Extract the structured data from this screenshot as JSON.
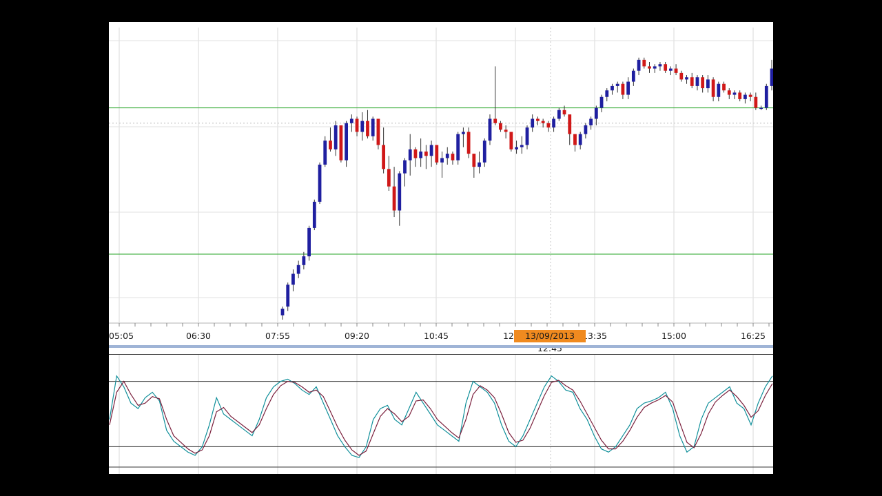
{
  "chart_data": [
    {
      "type": "candlestick",
      "x_tick_labels": [
        "05:05",
        "06:30",
        "07:55",
        "09:20",
        "10:45",
        "12:10",
        "13:35",
        "15:00",
        "16:25"
      ],
      "crosshair_label": "13/09/2013 12:45",
      "horizontal_lines": [
        {
          "name": "resistance",
          "value": 97,
          "color": "#2ea82e"
        },
        {
          "name": "support",
          "value": 30,
          "color": "#2ea82e"
        },
        {
          "name": "crosshair",
          "value": 90,
          "color": "#c7c7c7",
          "style": "dotted"
        }
      ],
      "ylim": [
        0,
        130
      ],
      "up_color": "#1f1fa0",
      "down_color": "#d01818",
      "candles": [
        {
          "o": 2,
          "h": 6,
          "l": 0,
          "c": 5
        },
        {
          "o": 6,
          "h": 17,
          "l": 4,
          "c": 16
        },
        {
          "o": 16,
          "h": 23,
          "l": 13,
          "c": 21
        },
        {
          "o": 21,
          "h": 27,
          "l": 19,
          "c": 25
        },
        {
          "o": 25,
          "h": 31,
          "l": 23,
          "c": 29
        },
        {
          "o": 29,
          "h": 43,
          "l": 27,
          "c": 42
        },
        {
          "o": 42,
          "h": 55,
          "l": 41,
          "c": 54
        },
        {
          "o": 54,
          "h": 72,
          "l": 53,
          "c": 71
        },
        {
          "o": 71,
          "h": 84,
          "l": 70,
          "c": 82
        },
        {
          "o": 82,
          "h": 88,
          "l": 77,
          "c": 78
        },
        {
          "o": 78,
          "h": 91,
          "l": 75,
          "c": 89
        },
        {
          "o": 89,
          "h": 87,
          "l": 72,
          "c": 73
        },
        {
          "o": 73,
          "h": 91,
          "l": 70,
          "c": 90
        },
        {
          "o": 90,
          "h": 94,
          "l": 86,
          "c": 92
        },
        {
          "o": 92,
          "h": 93,
          "l": 84,
          "c": 86
        },
        {
          "o": 86,
          "h": 95,
          "l": 82,
          "c": 91
        },
        {
          "o": 91,
          "h": 96,
          "l": 83,
          "c": 84
        },
        {
          "o": 84,
          "h": 93,
          "l": 82,
          "c": 92
        },
        {
          "o": 92,
          "h": 90,
          "l": 78,
          "c": 80
        },
        {
          "o": 80,
          "h": 88,
          "l": 67,
          "c": 69
        },
        {
          "o": 69,
          "h": 75,
          "l": 59,
          "c": 61
        },
        {
          "o": 61,
          "h": 70,
          "l": 47,
          "c": 50
        },
        {
          "o": 50,
          "h": 68,
          "l": 43,
          "c": 67
        },
        {
          "o": 67,
          "h": 74,
          "l": 61,
          "c": 73
        },
        {
          "o": 73,
          "h": 85,
          "l": 66,
          "c": 78
        },
        {
          "o": 78,
          "h": 79,
          "l": 70,
          "c": 74
        },
        {
          "o": 74,
          "h": 83,
          "l": 70,
          "c": 77
        },
        {
          "o": 77,
          "h": 80,
          "l": 69,
          "c": 75
        },
        {
          "o": 75,
          "h": 82,
          "l": 70,
          "c": 80
        },
        {
          "o": 80,
          "h": 79,
          "l": 71,
          "c": 72
        },
        {
          "o": 72,
          "h": 77,
          "l": 65,
          "c": 74
        },
        {
          "o": 74,
          "h": 79,
          "l": 71,
          "c": 76
        },
        {
          "o": 76,
          "h": 77,
          "l": 71,
          "c": 73
        },
        {
          "o": 73,
          "h": 86,
          "l": 71,
          "c": 85
        },
        {
          "o": 85,
          "h": 88,
          "l": 79,
          "c": 86
        },
        {
          "o": 86,
          "h": 88,
          "l": 74,
          "c": 76
        },
        {
          "o": 76,
          "h": 75,
          "l": 65,
          "c": 70
        },
        {
          "o": 70,
          "h": 77,
          "l": 67,
          "c": 72
        },
        {
          "o": 72,
          "h": 83,
          "l": 70,
          "c": 82
        },
        {
          "o": 82,
          "h": 94,
          "l": 80,
          "c": 92
        },
        {
          "o": 92,
          "h": 116,
          "l": 89,
          "c": 90
        },
        {
          "o": 90,
          "h": 91,
          "l": 86,
          "c": 87
        },
        {
          "o": 87,
          "h": 89,
          "l": 83,
          "c": 86
        },
        {
          "o": 86,
          "h": 84,
          "l": 77,
          "c": 78
        },
        {
          "o": 78,
          "h": 82,
          "l": 76,
          "c": 79
        },
        {
          "o": 79,
          "h": 84,
          "l": 76,
          "c": 80
        },
        {
          "o": 80,
          "h": 89,
          "l": 78,
          "c": 88
        },
        {
          "o": 88,
          "h": 94,
          "l": 86,
          "c": 92
        },
        {
          "o": 92,
          "h": 93,
          "l": 89,
          "c": 91
        },
        {
          "o": 91,
          "h": 92,
          "l": 88,
          "c": 90
        },
        {
          "o": 90,
          "h": 91,
          "l": 86,
          "c": 88
        },
        {
          "o": 88,
          "h": 93,
          "l": 86,
          "c": 92
        },
        {
          "o": 92,
          "h": 97,
          "l": 91,
          "c": 96
        },
        {
          "o": 96,
          "h": 98,
          "l": 93,
          "c": 94
        },
        {
          "o": 94,
          "h": 93,
          "l": 80,
          "c": 85
        },
        {
          "o": 85,
          "h": 84,
          "l": 77,
          "c": 80
        },
        {
          "o": 80,
          "h": 86,
          "l": 78,
          "c": 85
        },
        {
          "o": 85,
          "h": 90,
          "l": 83,
          "c": 89
        },
        {
          "o": 89,
          "h": 93,
          "l": 87,
          "c": 92
        },
        {
          "o": 92,
          "h": 98,
          "l": 89,
          "c": 97
        },
        {
          "o": 97,
          "h": 103,
          "l": 95,
          "c": 102
        },
        {
          "o": 102,
          "h": 106,
          "l": 100,
          "c": 105
        },
        {
          "o": 105,
          "h": 108,
          "l": 103,
          "c": 107
        },
        {
          "o": 107,
          "h": 109,
          "l": 104,
          "c": 108
        },
        {
          "o": 108,
          "h": 109,
          "l": 101,
          "c": 103
        },
        {
          "o": 103,
          "h": 111,
          "l": 101,
          "c": 109
        },
        {
          "o": 109,
          "h": 115,
          "l": 107,
          "c": 114
        },
        {
          "o": 114,
          "h": 120,
          "l": 112,
          "c": 119
        },
        {
          "o": 119,
          "h": 120,
          "l": 115,
          "c": 116
        },
        {
          "o": 116,
          "h": 118,
          "l": 113,
          "c": 115
        },
        {
          "o": 115,
          "h": 117,
          "l": 113,
          "c": 116
        },
        {
          "o": 116,
          "h": 118,
          "l": 114,
          "c": 117
        },
        {
          "o": 117,
          "h": 118,
          "l": 113,
          "c": 114
        },
        {
          "o": 114,
          "h": 116,
          "l": 112,
          "c": 115
        },
        {
          "o": 115,
          "h": 117,
          "l": 112,
          "c": 113
        },
        {
          "o": 113,
          "h": 114,
          "l": 109,
          "c": 110
        },
        {
          "o": 110,
          "h": 112,
          "l": 108,
          "c": 111
        },
        {
          "o": 111,
          "h": 113,
          "l": 106,
          "c": 107
        },
        {
          "o": 107,
          "h": 112,
          "l": 105,
          "c": 111
        },
        {
          "o": 111,
          "h": 112,
          "l": 104,
          "c": 106
        },
        {
          "o": 106,
          "h": 112,
          "l": 104,
          "c": 110
        },
        {
          "o": 110,
          "h": 111,
          "l": 100,
          "c": 102
        },
        {
          "o": 102,
          "h": 109,
          "l": 100,
          "c": 108
        },
        {
          "o": 108,
          "h": 109,
          "l": 104,
          "c": 105
        },
        {
          "o": 105,
          "h": 106,
          "l": 101,
          "c": 103
        },
        {
          "o": 103,
          "h": 105,
          "l": 101,
          "c": 104
        },
        {
          "o": 104,
          "h": 105,
          "l": 100,
          "c": 101
        },
        {
          "o": 101,
          "h": 104,
          "l": 99,
          "c": 103
        },
        {
          "o": 103,
          "h": 104,
          "l": 100,
          "c": 102
        },
        {
          "o": 102,
          "h": 104,
          "l": 96,
          "c": 97
        },
        {
          "o": 97,
          "h": 98,
          "l": 96,
          "c": 97
        },
        {
          "o": 97,
          "h": 108,
          "l": 96,
          "c": 107
        },
        {
          "o": 107,
          "h": 119,
          "l": 105,
          "c": 115
        }
      ]
    },
    {
      "type": "line",
      "name": "stochastic oscillator",
      "ylim": [
        0,
        100
      ],
      "levels": [
        80,
        20
      ],
      "series": [
        {
          "color": "#0f8f9a",
          "values": [
            45,
            85,
            75,
            60,
            55,
            65,
            70,
            62,
            35,
            25,
            20,
            15,
            12,
            20,
            40,
            65,
            50,
            45,
            40,
            35,
            30,
            45,
            65,
            75,
            80,
            82,
            78,
            72,
            68,
            75,
            60,
            45,
            30,
            20,
            12,
            10,
            20,
            45,
            55,
            58,
            45,
            40,
            55,
            70,
            60,
            50,
            40,
            35,
            30,
            25,
            60,
            80,
            75,
            70,
            60,
            40,
            25,
            20,
            30,
            45,
            60,
            75,
            85,
            80,
            72,
            70,
            55,
            45,
            30,
            18,
            15,
            20,
            30,
            40,
            55,
            60,
            62,
            65,
            70,
            55,
            30,
            15,
            20,
            45,
            60,
            65,
            70,
            75,
            60,
            55,
            40,
            60,
            75,
            85
          ]
        },
        {
          "color": "#7a1f3c",
          "values": [
            40,
            70,
            80,
            68,
            58,
            60,
            66,
            64,
            45,
            30,
            24,
            18,
            14,
            17,
            30,
            52,
            56,
            48,
            43,
            38,
            33,
            40,
            55,
            68,
            76,
            80,
            79,
            75,
            70,
            72,
            66,
            52,
            38,
            26,
            17,
            12,
            16,
            32,
            48,
            55,
            50,
            43,
            48,
            62,
            63,
            55,
            45,
            39,
            33,
            28,
            45,
            68,
            76,
            72,
            65,
            50,
            33,
            24,
            26,
            37,
            52,
            67,
            79,
            81,
            76,
            72,
            62,
            50,
            38,
            26,
            18,
            18,
            25,
            35,
            47,
            56,
            60,
            63,
            67,
            61,
            42,
            24,
            19,
            32,
            50,
            61,
            67,
            72,
            66,
            58,
            47,
            53,
            67,
            78
          ]
        }
      ]
    }
  ]
}
